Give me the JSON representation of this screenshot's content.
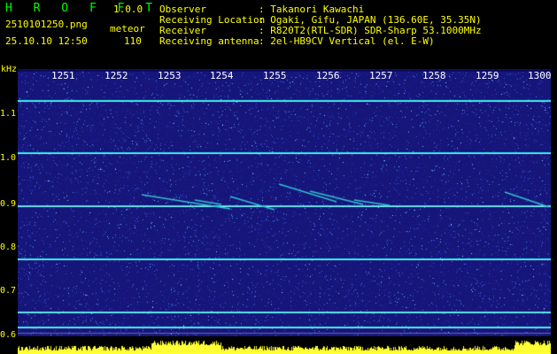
{
  "header": {
    "logo": "H R O F F T",
    "version": "1.0.0",
    "filename": "2510101250.png",
    "mode": "meteor",
    "datetime": "25.10.10 12:50",
    "count": "110",
    "fields": [
      {
        "label": "Observer",
        "value": ": Takanori Kawachi"
      },
      {
        "label": "Receiving Location",
        "value": ": Ogaki, Gifu, JAPAN (136.60E, 35.35N)"
      },
      {
        "label": "Receiver",
        "value": ": R820T2(RTL-SDR) SDR-Sharp 53.1000MHz"
      },
      {
        "label": "Receiving antenna",
        "value": ": 2el-HB9CV Vertical (el. E-W)"
      }
    ]
  },
  "yaxis": {
    "unit": "kHz",
    "ticks": [
      "1.1",
      "1.0",
      "0.9",
      "0.8",
      "0.7",
      "0.6"
    ]
  },
  "xaxis": {
    "ticks": [
      "1251",
      "1252",
      "1253",
      "1254",
      "1255",
      "1256",
      "1257",
      "1258",
      "1259",
      "1300"
    ]
  },
  "colors": {
    "background": "#15157a",
    "signal_line": "#22e0e0",
    "text_yellow": "#ffff00",
    "logo_green": "#00ff00",
    "activity": "#ffff33"
  }
}
